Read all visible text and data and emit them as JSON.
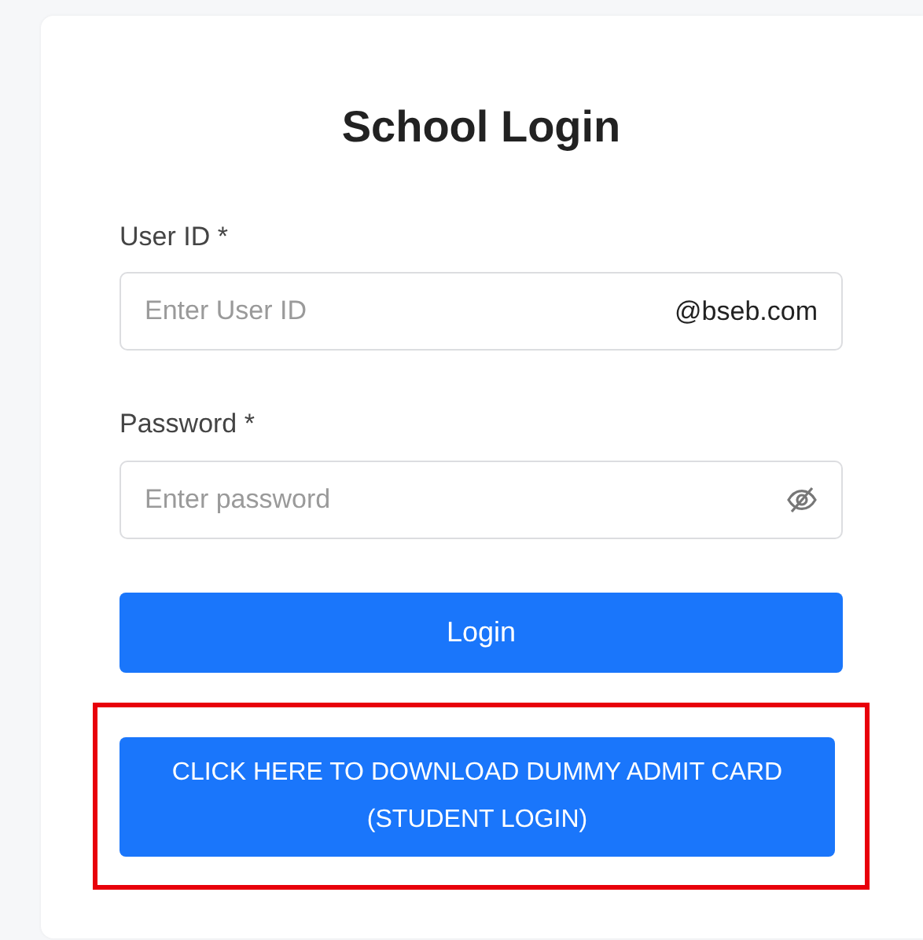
{
  "title": "School Login",
  "fields": [
    {
      "label": "User ID *",
      "placeholder": "Enter User ID",
      "kind": "suffix",
      "suffix": "@bseb.com"
    },
    {
      "label": "Password *",
      "placeholder": "Enter password",
      "kind": "password"
    }
  ],
  "login_button": "Login",
  "download_button": {
    "lines": [
      "CLICK HERE TO DOWNLOAD DUMMY ADMIT CARD",
      "(STUDENT LOGIN)"
    ],
    "highlighted": true
  }
}
